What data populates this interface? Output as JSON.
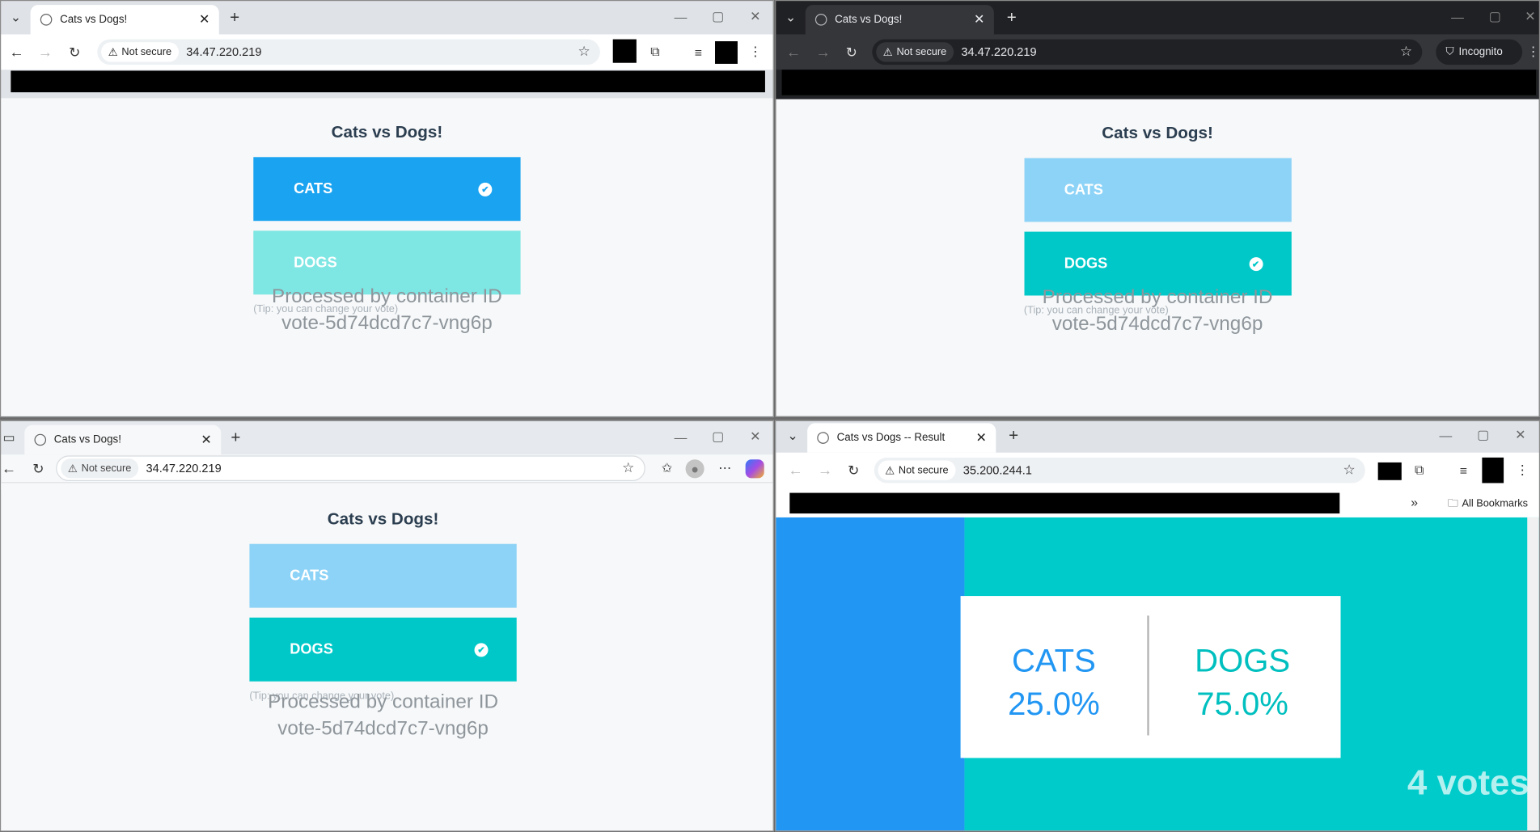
{
  "windows": [
    {
      "id": "tl",
      "tab_title": "Cats vs Dogs!",
      "security": "Not secure",
      "url": "34.47.220.219"
    },
    {
      "id": "tr",
      "tab_title": "Cats vs Dogs!",
      "security": "Not secure",
      "url": "34.47.220.219",
      "incognito": "Incognito"
    },
    {
      "id": "bl",
      "tab_title": "Cats vs Dogs!",
      "security": "Not secure",
      "url": "34.47.220.219"
    },
    {
      "id": "br",
      "tab_title": "Cats vs Dogs -- Result",
      "security": "Not secure",
      "url": "35.200.244.1",
      "bookmarks": "All Bookmarks"
    }
  ],
  "vote_page": {
    "title": "Cats vs Dogs!",
    "option_a": "CATS",
    "option_b": "DOGS",
    "tip": "(Tip: you can change your vote)",
    "processed_label": "Processed by container ID",
    "container_id": "vote-5d74dcd7c7-vng6p"
  },
  "result_page": {
    "cats_label": "CATS",
    "cats_pct": "25.0%",
    "dogs_label": "DOGS",
    "dogs_pct": "75.0%",
    "votes": "4 votes"
  },
  "colors": {
    "cats": "#1aa3f0",
    "dogs": "#00c8c8",
    "result_cats": "#2196f3",
    "result_dogs": "#00cbcb"
  },
  "icons": {
    "back": "arrow-left-icon",
    "forward": "arrow-right-icon",
    "reload": "reload-icon",
    "warning": "warning-icon",
    "star": "star-icon",
    "check": "check-icon",
    "extensions": "puzzle-icon"
  }
}
